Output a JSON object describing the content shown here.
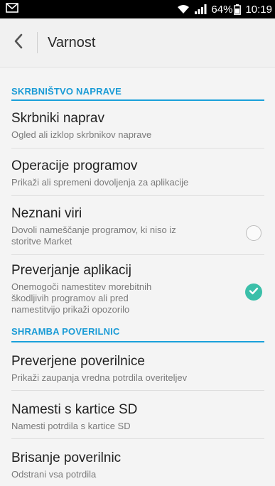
{
  "status_bar": {
    "battery": "64%",
    "time": "10:19",
    "icons": [
      "mail-icon",
      "wifi-icon",
      "signal-icon",
      "battery-icon"
    ]
  },
  "app_bar": {
    "title": "Varnost",
    "back_icon": "chevron-left-icon"
  },
  "sections": [
    {
      "header": "SKRBNIŠTVO NAPRAVE",
      "items": [
        {
          "title": "Skrbniki naprav",
          "subtitle": "Ogled ali izklop skrbnikov naprave"
        },
        {
          "title": "Operacije programov",
          "subtitle": "Prikaži ali spremeni dovoljenja za aplikacije"
        },
        {
          "title": "Neznani viri",
          "subtitle_lines": [
            "Dovoli nameščanje programov, ki niso iz",
            "storitve Market"
          ],
          "checked": false
        },
        {
          "title": "Preverjanje aplikacij",
          "subtitle_lines": [
            "Onemogoči namestitev morebitnih",
            "škodljivih programov ali pred",
            "namestitvijo prikaži opozorilo"
          ],
          "checked": true
        }
      ]
    },
    {
      "header": "SHRAMBA POVERILNIC",
      "items": [
        {
          "title": "Preverjene poverilnice",
          "subtitle": "Prikaži zaupanja vredna potrdila overiteljev"
        },
        {
          "title": "Namesti s kartice SD",
          "subtitle": "Namesti potrdila s kartice SD"
        },
        {
          "title": "Brisanje poverilnic",
          "subtitle": "Odstrani vsa potrdila"
        }
      ]
    }
  ],
  "colors": {
    "accent": "#1a9bd6",
    "check": "#3bbfa9",
    "statusbar": "#000000"
  }
}
